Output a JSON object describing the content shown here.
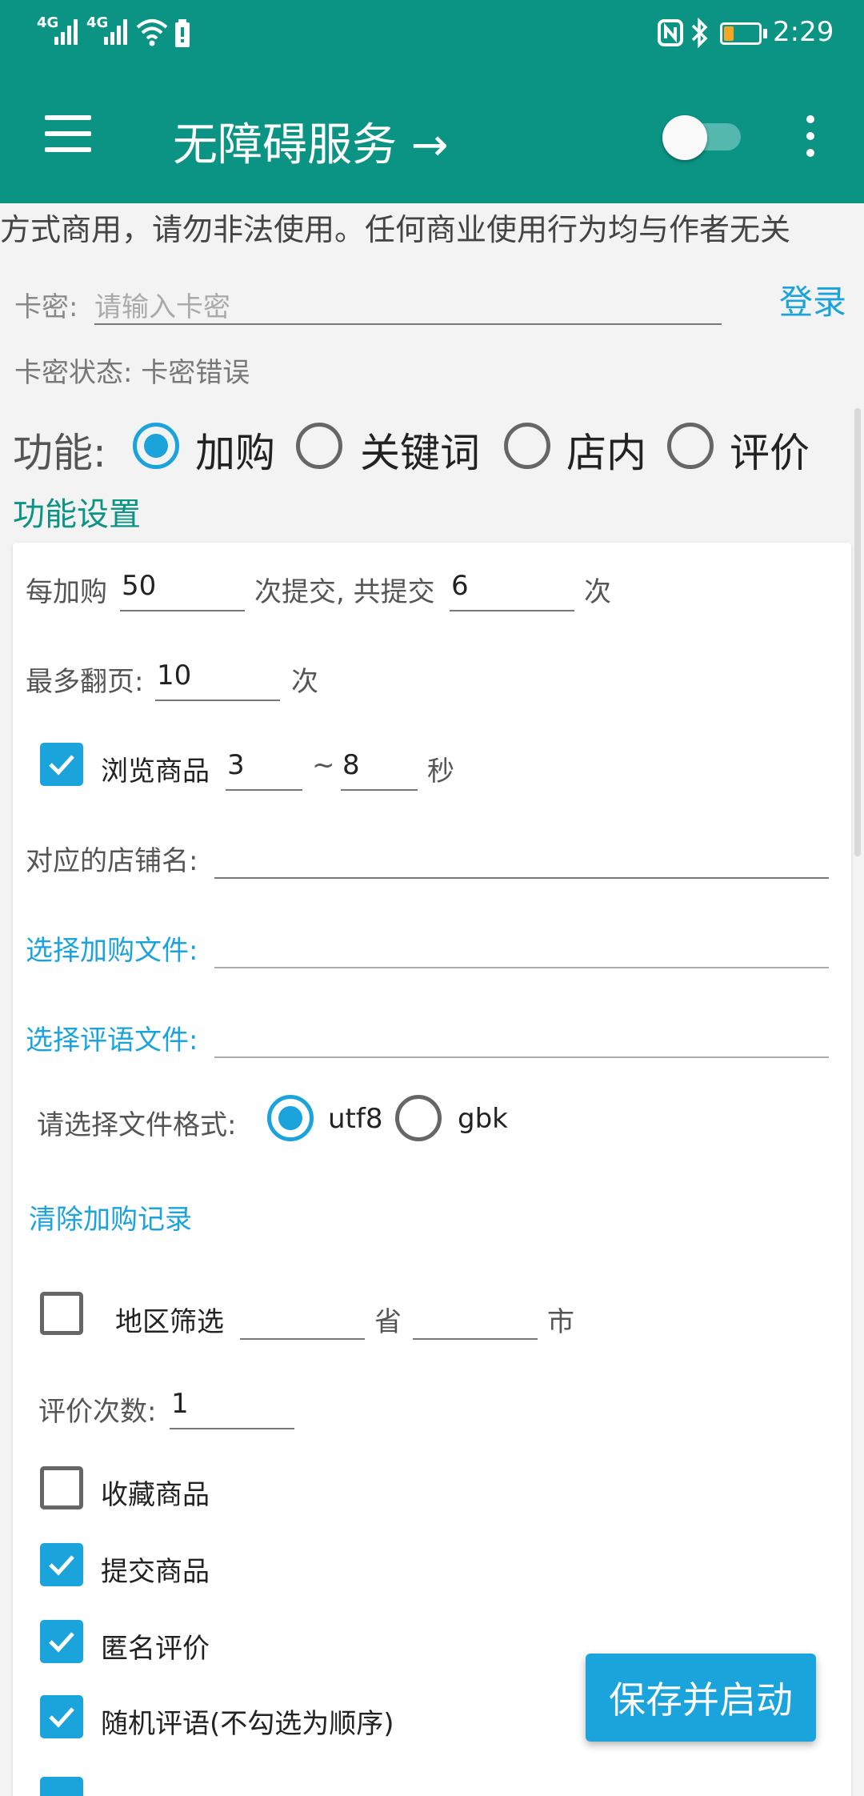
{
  "status_bar": {
    "net1": "4G",
    "net2": "4G",
    "time": "2:29"
  },
  "app_bar": {
    "title": "无障碍服务 →",
    "toggle_state": "off",
    "menu_icon": "hamburger-menu-icon",
    "more_icon": "more-vert-icon"
  },
  "colors": {
    "primary": "#0b9484",
    "accent": "#1ba3dc"
  },
  "notice": "方式商用，请勿非法使用。任何商业使用行为均与作者无关",
  "login": {
    "card_label": "卡密:",
    "card_placeholder": "请输入卡密",
    "login_button": "登录",
    "status_label": "卡密状态:",
    "status_value": "卡密错误"
  },
  "function": {
    "label": "功能:",
    "options": [
      "加购",
      "关键词",
      "店内",
      "评价"
    ],
    "selected": "加购"
  },
  "settings_title": "功能设置",
  "settings": {
    "per_add_label": "每加购",
    "per_add_value": "50",
    "submit_label": "次提交, 共提交",
    "submit_value": "6",
    "times_unit": "次",
    "max_pages_label": "最多翻页:",
    "max_pages_value": "10",
    "max_pages_unit": "次",
    "browse_label": "浏览商品",
    "browse_checked": true,
    "browse_min": "3",
    "browse_tilde": "~",
    "browse_max": "8",
    "browse_unit": "秒",
    "shop_name_label": "对应的店铺名:",
    "shop_name_value": "",
    "select_add_file": "选择加购文件:",
    "select_comment_file": "选择评语文件:",
    "file_format_label": "请选择文件格式:",
    "file_formats": [
      "utf8",
      "gbk"
    ],
    "file_format_selected": "utf8",
    "clear_records": "清除加购记录",
    "region_filter_label": "地区筛选",
    "region_filter_checked": false,
    "province_value": "",
    "province_unit": "省",
    "city_value": "",
    "city_unit": "市",
    "review_count_label": "评价次数:",
    "review_count_value": "1",
    "checkboxes": [
      {
        "label": "收藏商品",
        "checked": false
      },
      {
        "label": "提交商品",
        "checked": true
      },
      {
        "label": "匿名评价",
        "checked": true
      },
      {
        "label": "随机评语(不勾选为顺序)",
        "checked": true
      }
    ]
  },
  "save_button": "保存并启动"
}
